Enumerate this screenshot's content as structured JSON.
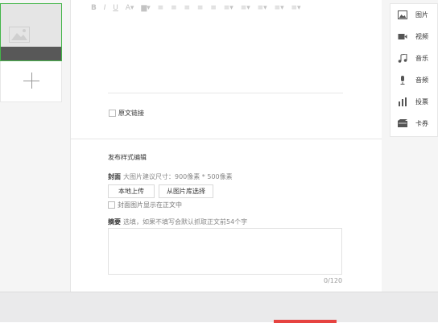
{
  "toolbar": {
    "buttons": [
      "B",
      "I",
      "U",
      "A▾",
      "▆▾",
      "≡",
      "≡",
      "≡",
      "≡",
      "≡",
      "≡▾",
      "≡▾",
      "≡▾",
      "≡▾",
      "≡▾"
    ]
  },
  "editor": {
    "source_link_label": "原文链接"
  },
  "publish": {
    "section_title": "发布样式编辑",
    "cover_label": "封面",
    "cover_hint": "大图片建议尺寸：900像素 * 500像素",
    "upload_local_label": "本地上传",
    "choose_library_label": "从图片库选择",
    "cover_show_label": "封面图片显示在正文中",
    "summary_label": "摘要",
    "summary_hint": "选填，如果不填写会默认抓取正文前54个字",
    "summary_value": "",
    "summary_count": "0/120"
  },
  "insert_panel": {
    "items": [
      {
        "label": "图片",
        "icon": "image-icon"
      },
      {
        "label": "视频",
        "icon": "video-icon"
      },
      {
        "label": "音乐",
        "icon": "music-icon"
      },
      {
        "label": "音频",
        "icon": "microphone-icon"
      },
      {
        "label": "投票",
        "icon": "vote-icon"
      },
      {
        "label": "卡券",
        "icon": "card-icon"
      }
    ]
  },
  "colors": {
    "accent_green": "#44b549",
    "accent_red": "#e64340"
  }
}
